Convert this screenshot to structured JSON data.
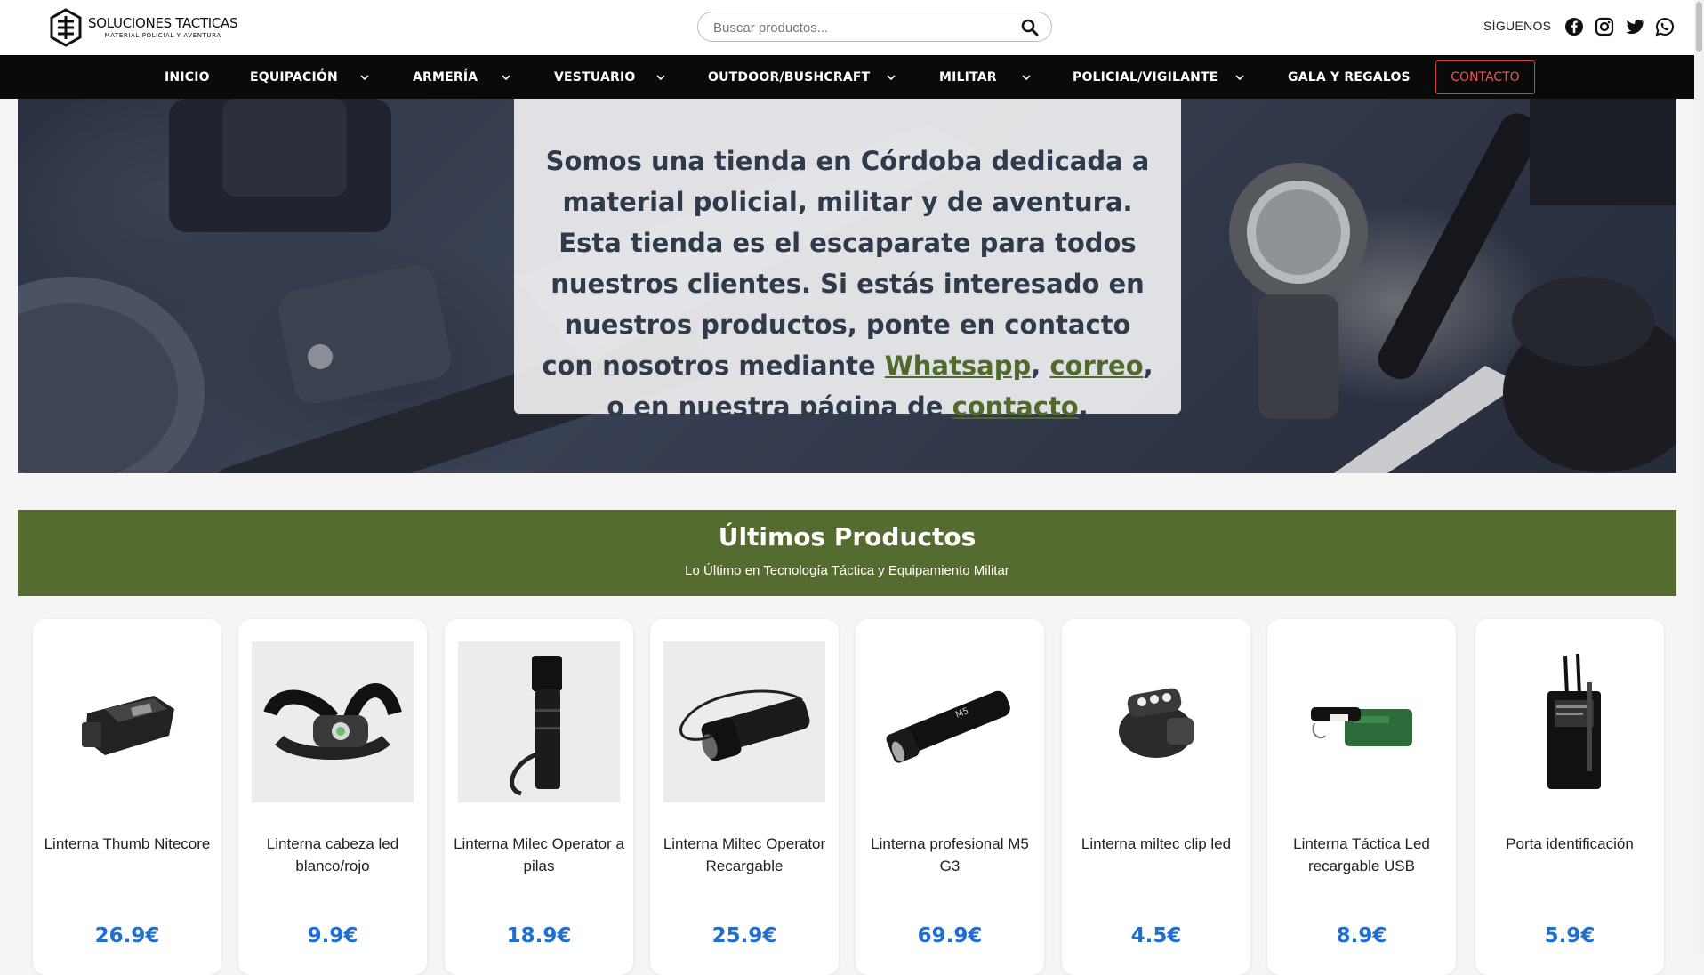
{
  "header": {
    "logo_title": "SOLUCIONES TACTICAS",
    "logo_subtitle": "MATERIAL POLICIAL Y AVENTURA",
    "search_placeholder": "Buscar productos...",
    "follow_label": "SÍGUENOS",
    "social_icons": [
      "facebook-icon",
      "instagram-icon",
      "twitter-icon",
      "whatsapp-icon"
    ]
  },
  "nav": {
    "items": [
      {
        "label": "INICIO",
        "dropdown": false
      },
      {
        "label": "EQUIPACIÓN",
        "dropdown": true
      },
      {
        "label": "ARMERÍA",
        "dropdown": true
      },
      {
        "label": "VESTUARIO",
        "dropdown": true
      },
      {
        "label": "OUTDOOR/BUSHCRAFT",
        "dropdown": true
      },
      {
        "label": "MILITAR",
        "dropdown": true
      },
      {
        "label": "POLICIAL/VIGILANTE",
        "dropdown": true
      },
      {
        "label": "GALA Y REGALOS",
        "dropdown": false
      }
    ],
    "contact_label": "CONTACTO"
  },
  "hero": {
    "text_part1": "Somos una tienda en Córdoba dedicada a material policial, militar y de aventura. Esta tienda es el escaparate para todos nuestros clientes. Si estás interesado en nuestros productos, ponte en contacto con nosotros mediante ",
    "link_whatsapp": "Whatsapp",
    "text_part2": ", ",
    "link_correo": "correo",
    "text_part3": ", o en nuestra página de ",
    "link_contacto": "contacto",
    "text_part4": "."
  },
  "section": {
    "title": "Últimos Productos",
    "subtitle": "Lo Último en Tecnología Táctica y Equipamiento Militar"
  },
  "products": [
    {
      "name": "Linterna Thumb Nitecore",
      "price": "26.9€"
    },
    {
      "name": "Linterna cabeza led blanco/rojo",
      "price": "9.9€"
    },
    {
      "name": "Linterna Milec Operator a pilas",
      "price": "18.9€"
    },
    {
      "name": "Linterna Miltec Operator Recargable",
      "price": "25.9€"
    },
    {
      "name": "Linterna profesional M5 G3",
      "price": "69.9€"
    },
    {
      "name": "Linterna miltec clip led",
      "price": "4.5€"
    },
    {
      "name": "Linterna Táctica Led recargable USB",
      "price": "8.9€"
    },
    {
      "name": "Porta identificación",
      "price": "5.9€"
    }
  ],
  "colors": {
    "nav_bg": "#0a0a0a",
    "section_green": "#566b2f",
    "link_green": "#4f6a2a",
    "price_blue": "#1f6fd1",
    "contact_red": "#d9403a"
  }
}
